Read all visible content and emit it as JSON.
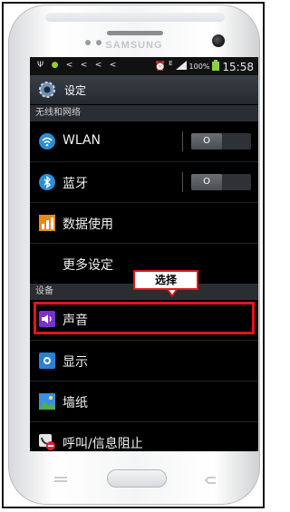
{
  "device": {
    "brand": "SAMSUNG"
  },
  "status_bar": {
    "left_icons": [
      "usb-icon",
      "android-debug-icon",
      "share-icon",
      "share-icon",
      "share-icon",
      "share-icon"
    ],
    "right_icons": [
      "alarm-icon",
      "edge-network-icon",
      "signal-icon",
      "battery-icon"
    ],
    "network_letter": "E",
    "battery": "100%",
    "time": "15:58"
  },
  "header": {
    "title": "设定"
  },
  "sections": [
    {
      "title": "无线和网络",
      "items": [
        {
          "label": "WLAN",
          "icon": "wifi-icon",
          "toggle": "O"
        },
        {
          "label": "蓝牙",
          "icon": "bluetooth-icon",
          "toggle": "O"
        },
        {
          "label": "数据使用",
          "icon": "data-usage-icon"
        },
        {
          "label": "更多设定"
        }
      ]
    },
    {
      "title": "设备",
      "items": [
        {
          "label": "声音",
          "icon": "volume-icon"
        },
        {
          "label": "显示",
          "icon": "display-icon"
        },
        {
          "label": "墙纸",
          "icon": "wallpaper-icon"
        },
        {
          "label": "呼叫/信息阻止",
          "icon": "call-block-icon"
        }
      ]
    }
  ],
  "annotation": {
    "callout_text": "选择",
    "highlight_color": "#e3151a"
  },
  "colors": {
    "accent_red": "#e3151a",
    "screen_bg": "#000000",
    "section_bg": "#2a2d31"
  }
}
